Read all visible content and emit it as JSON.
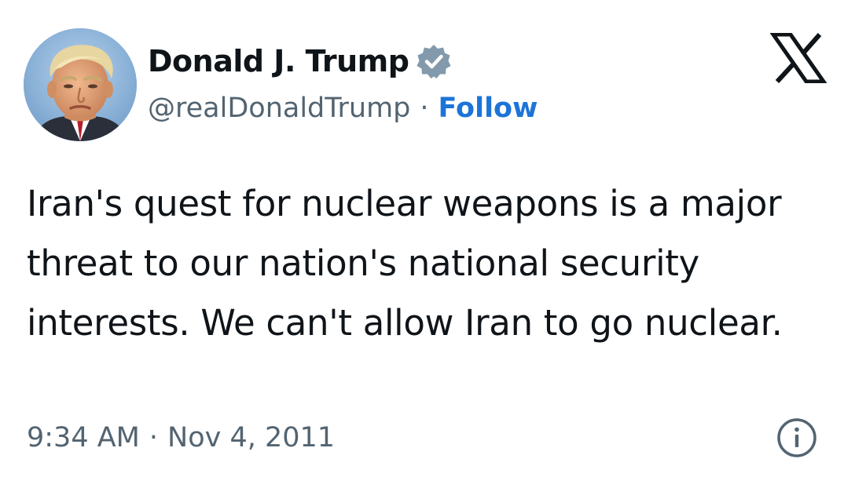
{
  "author": {
    "display_name": "Donald J. Trump",
    "handle": "@realDonaldTrump",
    "separator": "·",
    "follow_label": "Follow",
    "verified_icon": "verified-badge-icon",
    "avatar": "profile-photo"
  },
  "platform_logo": "x-logo-icon",
  "tweet": {
    "text": "Iran's quest for nuclear weapons is a major threat to our nation's national security interests. We can't allow Iran to go nuclear."
  },
  "meta": {
    "time": "9:34 AM",
    "separator": "·",
    "date": "Nov 4, 2011",
    "info_icon": "info-icon"
  },
  "colors": {
    "text": "#0f1419",
    "secondary_text": "#536471",
    "link": "#1d74d8",
    "badge": "#829aab"
  }
}
